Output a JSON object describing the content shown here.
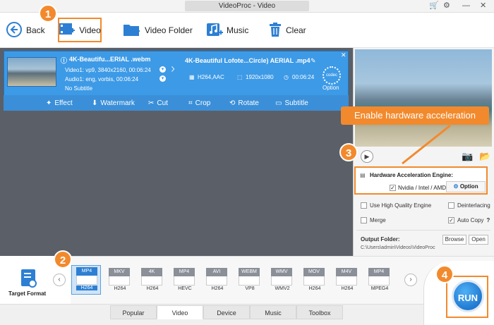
{
  "window": {
    "title": "VideoProc - Video"
  },
  "toolbar": {
    "back": "Back",
    "video": "Video",
    "video_folder": "Video Folder",
    "music": "Music",
    "clear": "Clear"
  },
  "file": {
    "source_name": "4K-Beautifu...ERIAL .webm",
    "video_info": "Video1: vp9, 3840x2160, 00:06:24",
    "audio_info": "Audio1: eng, vorbis, 00:06:24",
    "subtitle": "No Subtitle",
    "output_name": "4K-Beautiful Lofote...Circle) AERIAL .mp4",
    "codec": "H264,AAC",
    "resolution": "1920x1080",
    "duration": "00:06:24",
    "codec_badge": "codec",
    "option": "Option"
  },
  "edit_tools": [
    "Effect",
    "Watermark",
    "Cut",
    "Crop",
    "Rotate",
    "Subtitle"
  ],
  "callouts": {
    "b1": "1",
    "b2": "2",
    "b3": "3",
    "b4": "4",
    "tooltip": "Enable hardware acceleration"
  },
  "hw": {
    "title": "Hardware Acceleration Engine:",
    "gpu": "Nvidia / Intel / AMD",
    "option": "Option"
  },
  "settings": {
    "high_quality": "Use High Quality Engine",
    "deinterlacing": "Deinterlacing",
    "merge": "Merge",
    "auto_copy": "Auto Copy",
    "help": "?"
  },
  "output": {
    "label": "Output Folder:",
    "path": "C:\\Users\\admin\\Videos\\VideoProc",
    "browse": "Browse",
    "open": "Open"
  },
  "target_format": "Target Format",
  "formats": [
    {
      "container": "MP4",
      "codec": "H264",
      "selected": true
    },
    {
      "container": "MKV",
      "codec": "H264"
    },
    {
      "container": "4K",
      "codec": "H264"
    },
    {
      "container": "MP4",
      "codec": "HEVC"
    },
    {
      "container": "AVI",
      "codec": "H264"
    },
    {
      "container": "WEBM",
      "codec": "VP8"
    },
    {
      "container": "WMV",
      "codec": "WMV2"
    },
    {
      "container": "MOV",
      "codec": "H264"
    },
    {
      "container": "M4V",
      "codec": "H264"
    },
    {
      "container": "MP4",
      "codec": "MPEG4"
    }
  ],
  "tabs": [
    "Popular",
    "Video",
    "Device",
    "Music",
    "Toolbox"
  ],
  "run": "RUN",
  "colors": {
    "accent": "#f28a2d",
    "primary": "#3d9ae6",
    "work_bg": "#5b5f67"
  }
}
